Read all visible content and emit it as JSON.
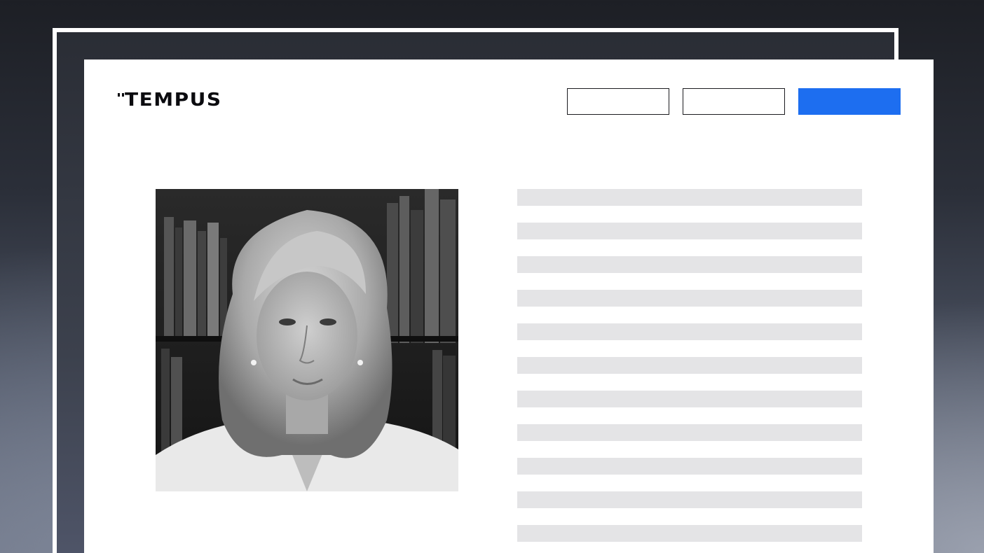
{
  "brand": {
    "name": "TEMPUS"
  },
  "header": {
    "nav_buttons": [
      {
        "style": "outline"
      },
      {
        "style": "outline"
      },
      {
        "style": "primary",
        "color": "#1d6ef0"
      }
    ]
  },
  "profile": {
    "photo_icon": "person-portrait",
    "placeholder_line_count": 11
  },
  "colors": {
    "accent": "#1d6ef0",
    "placeholder": "#e4e4e6",
    "text": "#0b0b0f"
  }
}
